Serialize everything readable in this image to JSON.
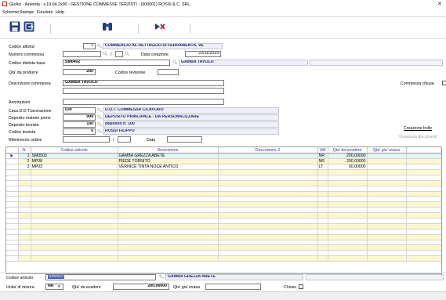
{
  "window": {
    "title": "GisAci - Azienda - v.19.04.2x00 - GESTIONE COMMESSE TERZISTI - (000001) ROSSI & C. SRL."
  },
  "menu": [
    "Schermo",
    "Stampe",
    "Funzioni",
    "Help"
  ],
  "icons": {
    "save": "save-icon",
    "exit": "exit-icon",
    "search": "binoculars-icon",
    "delete": "delete-icon"
  },
  "header": {
    "codice_attivita_label": "Codice attivita'",
    "codice_attivita_value": "1",
    "codice_attivita_desc": "COMMERCIO AL DETTAGLIO DI FERRAMENTA, VE",
    "numero_commessa_label": "Numero commessa",
    "numero_commessa_value": "",
    "numero_commessa_sep": "/",
    "data_creazione_label": "Data creazione",
    "data_creazione_value": "22/11/2019",
    "codice_distinta_label": "Codice distinta base",
    "codice_distinta_value": "SM0402",
    "codice_distinta_desc": "GAMBA TAVOLO",
    "qta_produrre_label": "Qta' da produrre",
    "qta_produrre_value": "200",
    "codice_revisione_label": "Codice revisione",
    "codice_revisione_value": "",
    "descrizione_commessa_label": "Descrizione commessa",
    "descrizione_commessa_value": "GAMBA TAVOLO",
    "commessa_chiusa_label": "Commessa chiusa",
    "annotazioni_label": "Annotazioni",
    "caus_label": "Caus.D.D.T.lavorazione",
    "caus_value": "030",
    "caus_desc": "D.D.T. COMMESSA C/LAVORO",
    "dep_materie_label": "Deposito materie prime",
    "dep_materie_value": "999",
    "dep_materie_desc": "DEPOSITO PRINCIPALE - DA PERSONALIZZARE",
    "dep_terzista_label": "Deposito terzista",
    "dep_terzista_value": "100",
    "dep_terzista_desc": "deposito n. 100",
    "cod_terzista_label": "Codice terzista",
    "cod_terzista_value": "5",
    "cod_terzista_desc": "ROSSI FILIPPO",
    "ritiro_label": "Riferimento ordine",
    "ritiro_sep": "/",
    "data_label": "Data",
    "creazione_bolle": "Creazione bolle",
    "visualizza_documenti": "Visualizza documenti"
  },
  "grid": {
    "columns": [
      "N.",
      "Codice articolo",
      "Descrizione",
      "Descrizione 2",
      "UM",
      "Qta' da evadere",
      "Qta' gia' evasa"
    ],
    "rows": [
      {
        "n": "1",
        "codice": "SM0503",
        "descrizione": "GAMBA GREZZA ABETE",
        "descrizione2": "",
        "um": "NR",
        "qta_evadere": "200,00000",
        "qta_evasa": ""
      },
      {
        "n": "2",
        "codice": "MP08",
        "descrizione": "PIEDE TORNITO",
        "descrizione2": "",
        "um": "NR",
        "qta_evadere": "200,00000",
        "qta_evasa": ""
      },
      {
        "n": "3",
        "codice": "MP03",
        "descrizione": "VERNICE TINTA NOCE ANTICO",
        "descrizione2": "",
        "um": "LT",
        "qta_evadere": "60,00000",
        "qta_evasa": ""
      }
    ]
  },
  "footer": {
    "codice_articolo_label": "Codice articolo",
    "codice_articolo_value": "SM0503",
    "codice_articolo_desc": "GAMBA GREZZA ABETE",
    "unita_label": "Unita' di misura",
    "unita_value": "NR",
    "qta_evadere_label": "Qta' da evadere",
    "qta_evadere_value": "200,00000",
    "qta_evasa_label": "Qta' gia' evasa",
    "chiuso_label": "Chiuso"
  }
}
